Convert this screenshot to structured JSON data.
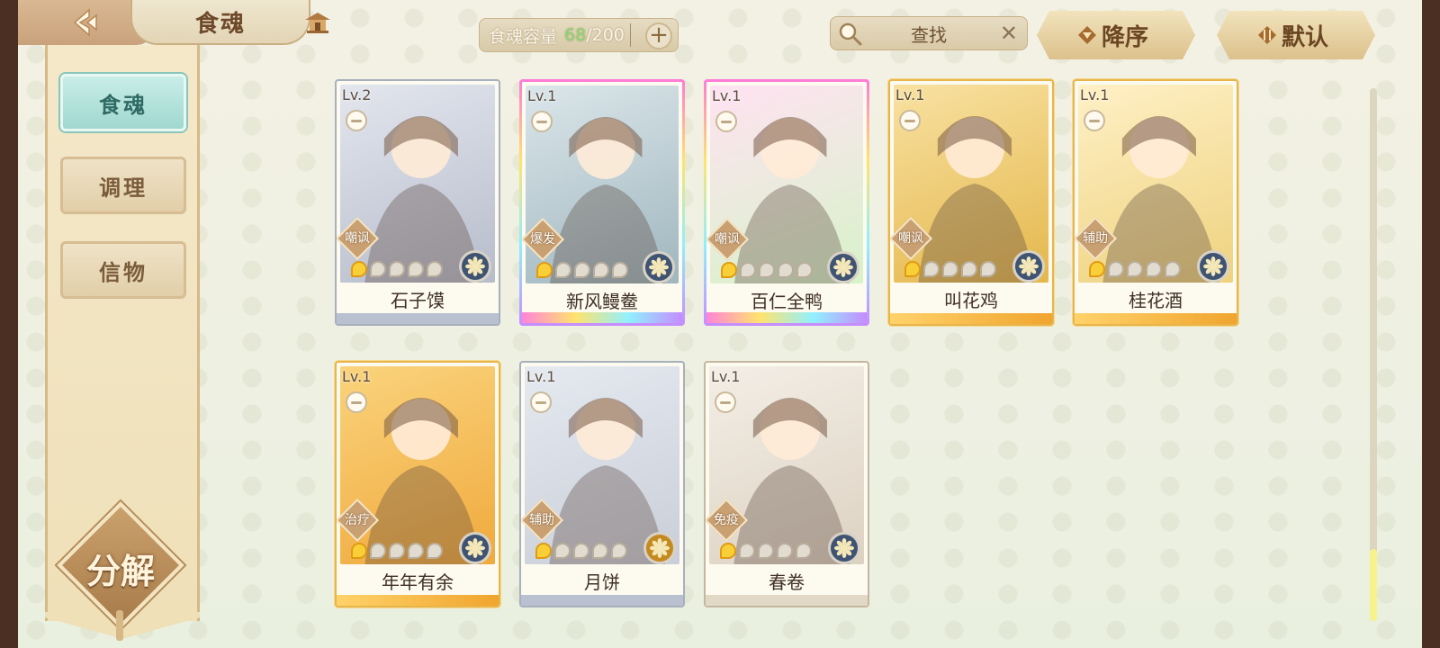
{
  "header": {
    "title": "食魂",
    "back_icon": "back-arrow-icon",
    "home_icon": "pavilion-icon"
  },
  "capacity": {
    "label": "食魂容量",
    "current": "68",
    "separator_max": "/200",
    "plus": "+"
  },
  "search": {
    "placeholder": "查找",
    "clear": "✕"
  },
  "sort": {
    "order_label": "降序",
    "default_label": "默认"
  },
  "side_nav": {
    "items": [
      {
        "label": "食魂",
        "active": true
      },
      {
        "label": "调理",
        "active": false
      },
      {
        "label": "信物",
        "active": false
      }
    ],
    "decompose_label": "分解"
  },
  "cards": [
    {
      "name": "石子馍",
      "level": "Lv.2",
      "role": "嘲讽",
      "stars": 1,
      "frame": "silver",
      "element": "gear-icon",
      "palette": [
        "#e3e6ee",
        "#b7bccb"
      ]
    },
    {
      "name": "新风鳗鲞",
      "level": "Lv.1",
      "role": "爆发",
      "stars": 1,
      "frame": "rainbow",
      "element": "gear-icon",
      "palette": [
        "#dbe6ea",
        "#9fb6be"
      ]
    },
    {
      "name": "百仁全鸭",
      "level": "Lv.1",
      "role": "嘲讽",
      "stars": 1,
      "frame": "rainbow",
      "element": "gear-icon",
      "palette": [
        "#ffe2f2",
        "#d7f3c9"
      ]
    },
    {
      "name": "叫花鸡",
      "level": "Lv.1",
      "role": "嘲讽",
      "stars": 1,
      "frame": "gold",
      "element": "gear-icon",
      "palette": [
        "#f8e1a1",
        "#e4b74c"
      ]
    },
    {
      "name": "桂花酒",
      "level": "Lv.1",
      "role": "辅助",
      "stars": 1,
      "frame": "gold",
      "element": "gear-icon",
      "palette": [
        "#fff0c6",
        "#eed27e"
      ]
    },
    {
      "name": "年年有余",
      "level": "Lv.1",
      "role": "治疗",
      "stars": 1,
      "frame": "gold",
      "element": "gear-icon",
      "palette": [
        "#fad37c",
        "#f0a93d"
      ]
    },
    {
      "name": "月饼",
      "level": "Lv.1",
      "role": "辅助",
      "stars": 1,
      "frame": "silver",
      "element": "flower-icon",
      "palette": [
        "#e5e9f0",
        "#c9ced8"
      ]
    },
    {
      "name": "春卷",
      "level": "Lv.1",
      "role": "免疫",
      "stars": 1,
      "frame": "plain",
      "element": "gear-icon",
      "palette": [
        "#f3eee6",
        "#ddd2c2"
      ]
    }
  ],
  "colors": {
    "accent_teal": "#9fd8d0",
    "gold": "#e8b54c",
    "capacity_current": "#8ad86e"
  }
}
